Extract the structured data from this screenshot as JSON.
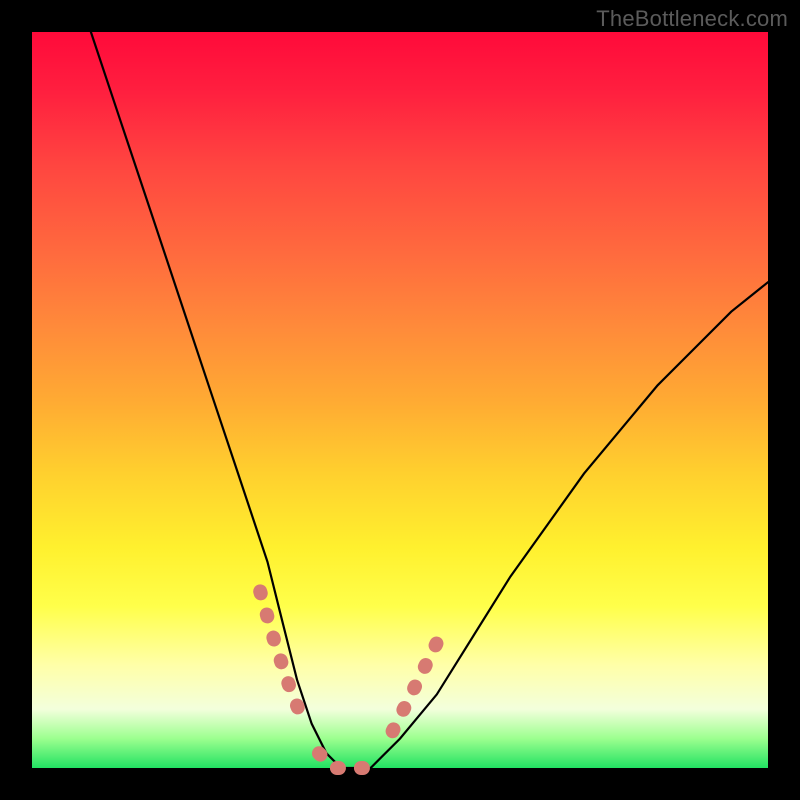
{
  "watermark": "TheBottleneck.com",
  "chart_data": {
    "type": "line",
    "title": "",
    "xlabel": "",
    "ylabel": "",
    "xlim": [
      0,
      100
    ],
    "ylim": [
      0,
      100
    ],
    "series": [
      {
        "name": "bottleneck-curve",
        "x": [
          8,
          12,
          16,
          20,
          24,
          28,
          32,
          34,
          36,
          38,
          40,
          42,
          44,
          46,
          50,
          55,
          60,
          65,
          70,
          75,
          80,
          85,
          90,
          95,
          100
        ],
        "y": [
          100,
          88,
          76,
          64,
          52,
          40,
          28,
          20,
          12,
          6,
          2,
          0,
          0,
          0,
          4,
          10,
          18,
          26,
          33,
          40,
          46,
          52,
          57,
          62,
          66
        ]
      }
    ],
    "highlight_segments": [
      {
        "name": "left-dip-marker",
        "x": [
          31,
          33,
          35,
          37
        ],
        "y": [
          24,
          17,
          11,
          6
        ]
      },
      {
        "name": "floor-marker",
        "x": [
          39,
          41,
          43,
          45,
          47
        ],
        "y": [
          2,
          0,
          0,
          0,
          2
        ]
      },
      {
        "name": "right-dip-marker",
        "x": [
          49,
          51,
          53,
          55
        ],
        "y": [
          5,
          9,
          13,
          17
        ]
      }
    ],
    "gradient_stops": [
      {
        "pct": 0,
        "color": "#ff0a3a"
      },
      {
        "pct": 30,
        "color": "#ff6a3e"
      },
      {
        "pct": 60,
        "color": "#ffd02e"
      },
      {
        "pct": 86,
        "color": "#ffffa8"
      },
      {
        "pct": 100,
        "color": "#22e262"
      }
    ]
  }
}
